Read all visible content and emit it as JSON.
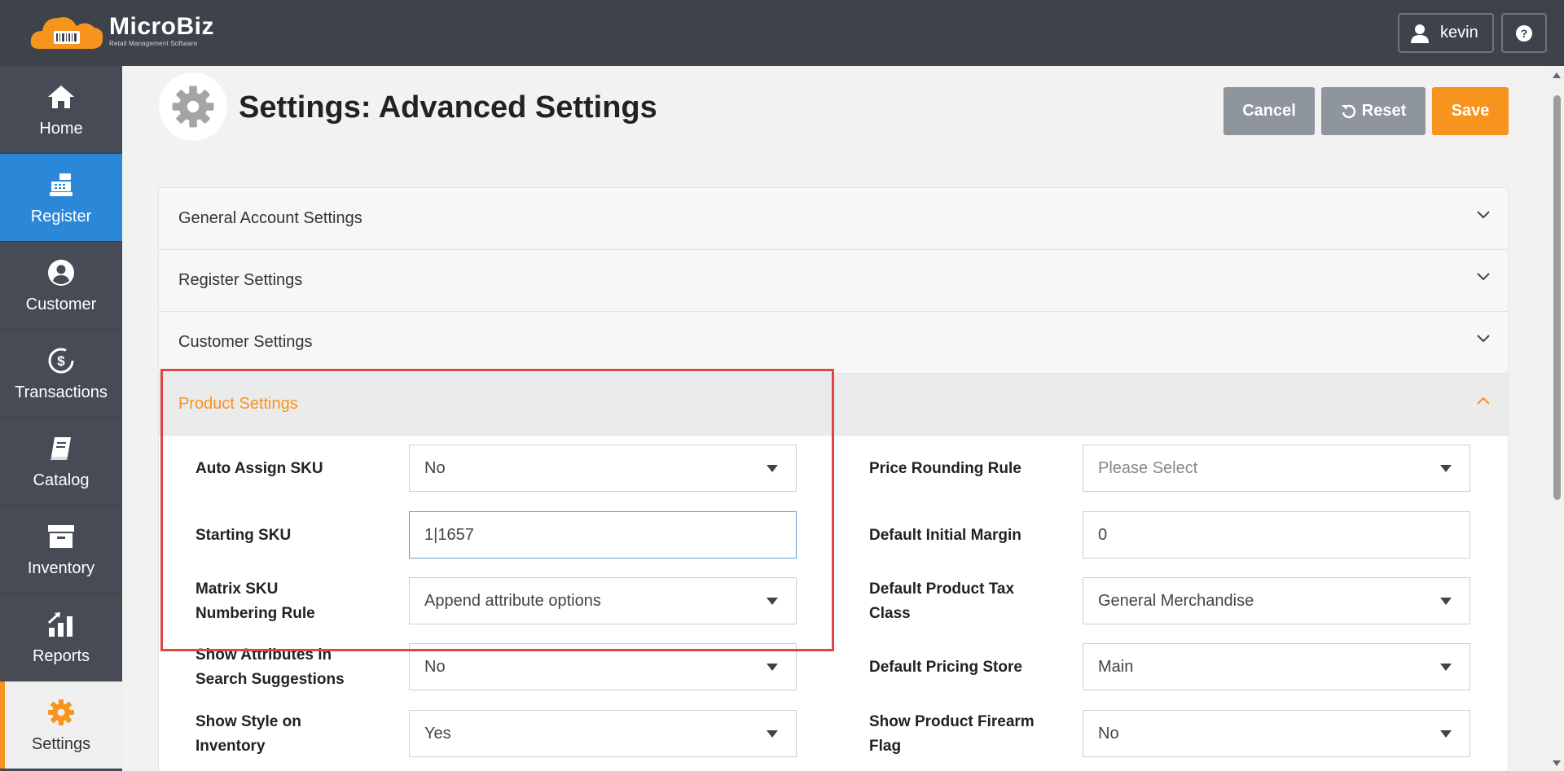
{
  "app": {
    "brand_name": "MicroBiz",
    "brand_tagline": "Retail Management Software",
    "user_name": "kevin",
    "help_icon": "question-circle-icon"
  },
  "sidebar": {
    "items": [
      {
        "label": "Home",
        "icon": "home-icon"
      },
      {
        "label": "Register",
        "icon": "cash-register-icon"
      },
      {
        "label": "Customer",
        "icon": "user-circle-icon"
      },
      {
        "label": "Transactions",
        "icon": "dollar-cycle-icon"
      },
      {
        "label": "Catalog",
        "icon": "book-icon"
      },
      {
        "label": "Inventory",
        "icon": "archive-box-icon"
      },
      {
        "label": "Reports",
        "icon": "chart-growth-icon"
      },
      {
        "label": "Settings",
        "icon": "gear-icon"
      }
    ],
    "active_item": "Register",
    "current_page_item": "Settings"
  },
  "header": {
    "title": "Settings: Advanced Settings",
    "cancel_label": "Cancel",
    "reset_label": "Reset",
    "save_label": "Save"
  },
  "sections": [
    {
      "label": "General Account Settings",
      "expanded": false
    },
    {
      "label": "Register Settings",
      "expanded": false
    },
    {
      "label": "Customer Settings",
      "expanded": false
    },
    {
      "label": "Product Settings",
      "expanded": true
    }
  ],
  "product_settings": {
    "left": [
      {
        "label": "Auto Assign SKU",
        "value": "No",
        "type": "select"
      },
      {
        "label": "Starting SKU",
        "value": "1|1657",
        "type": "text"
      },
      {
        "label": "Matrix SKU Numbering Rule",
        "value": "Append attribute options",
        "type": "select"
      },
      {
        "label": "Show Attributes in Search Suggestions",
        "value": "No",
        "type": "select"
      },
      {
        "label": "Show Style on Inventory",
        "value": "Yes",
        "type": "select"
      }
    ],
    "right": [
      {
        "label": "Price Rounding Rule",
        "value": "Please Select",
        "type": "select"
      },
      {
        "label": "Default Initial Margin",
        "value": "0",
        "type": "text"
      },
      {
        "label": "Default Product Tax Class",
        "value": "General Merchandise",
        "type": "select"
      },
      {
        "label": "Default Pricing Store",
        "value": "Main",
        "type": "select"
      },
      {
        "label": "Show Product Firearm Flag",
        "value": "No",
        "type": "select"
      }
    ]
  },
  "colors": {
    "topbar": "#3d424b",
    "sidebar": "#464b55",
    "active_nav": "#2b88d8",
    "accent": "#f7941d",
    "highlight_box": "#e04646"
  }
}
